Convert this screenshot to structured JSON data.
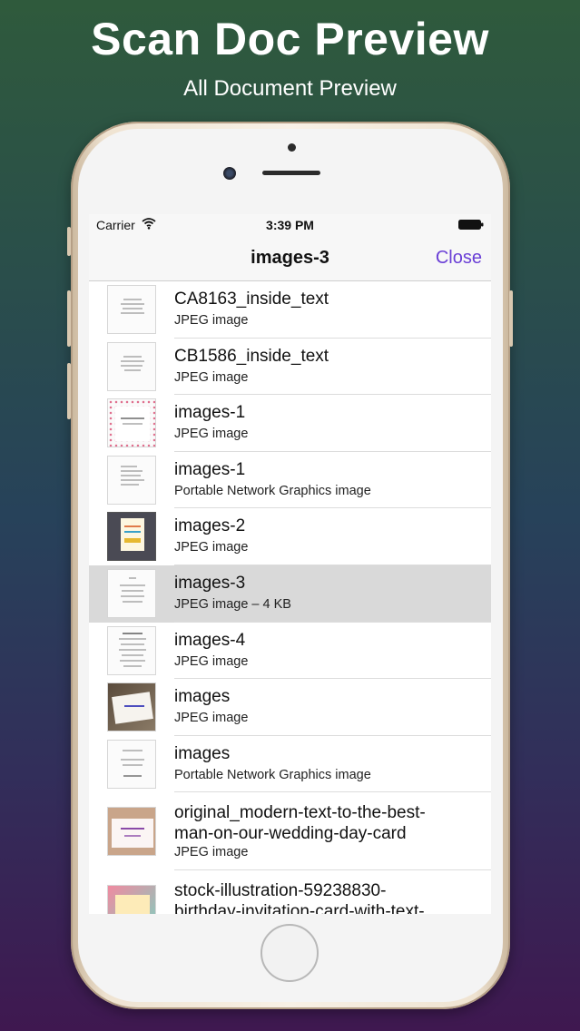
{
  "promo": {
    "title": "Scan Doc Preview",
    "subtitle": "All Document Preview"
  },
  "status_bar": {
    "carrier": "Carrier",
    "time": "3:39 PM"
  },
  "nav": {
    "title": "images-3",
    "close_label": "Close"
  },
  "files": [
    {
      "name": "CA8163_inside_text",
      "type": "JPEG image"
    },
    {
      "name": "CB1586_inside_text",
      "type": "JPEG image"
    },
    {
      "name": "images-1",
      "type": "JPEG image"
    },
    {
      "name": "images-1",
      "type": "Portable Network Graphics image"
    },
    {
      "name": "images-2",
      "type": "JPEG image"
    },
    {
      "name": "images-3",
      "type": "JPEG image – 4 KB"
    },
    {
      "name": "images-4",
      "type": "JPEG image"
    },
    {
      "name": "images",
      "type": "JPEG image"
    },
    {
      "name": "images",
      "type": "Portable Network Graphics image"
    },
    {
      "name": "original_modern-text-to-the-best-\nman-on-our-wedding-day-card",
      "type": "JPEG image"
    },
    {
      "name": "stock-illustration-59238830-\nbirthday-invitation-card-with-text-",
      "type": ""
    }
  ],
  "colors": {
    "accent": "#6a3fd6",
    "selected_row": "#d9d9d9"
  }
}
